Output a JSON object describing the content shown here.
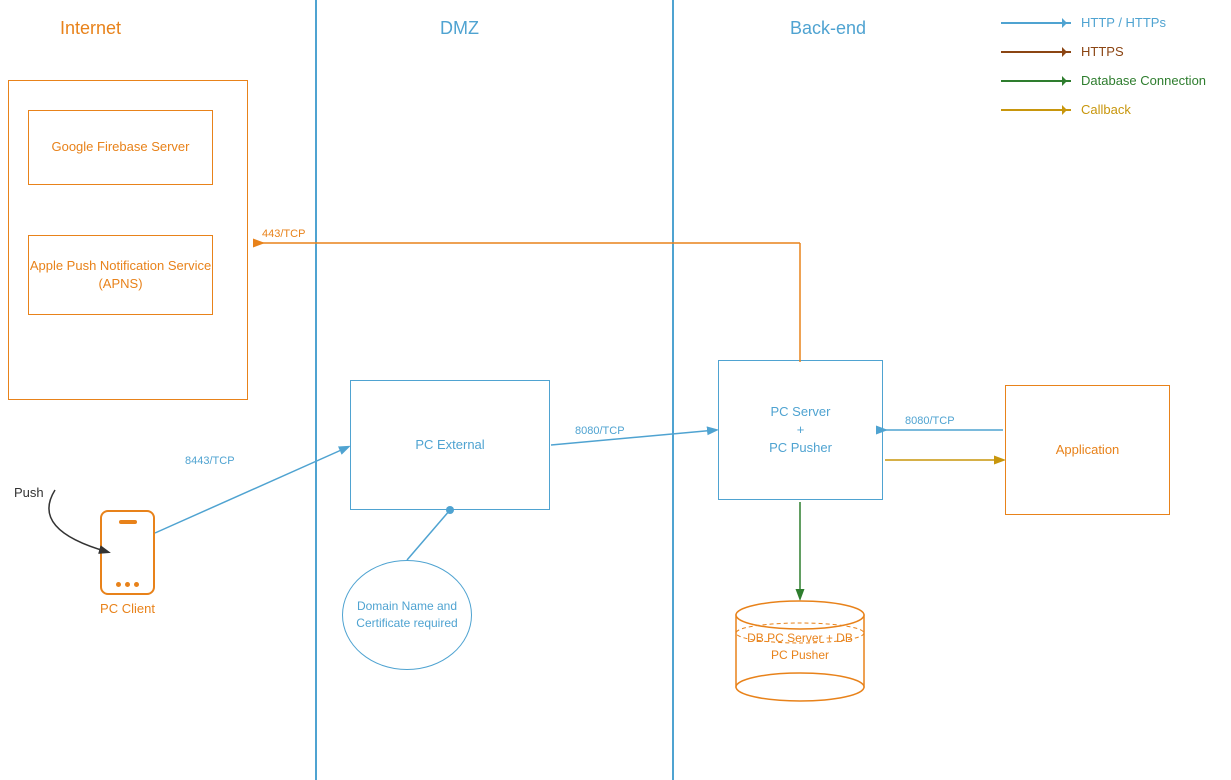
{
  "zones": {
    "internet": "Internet",
    "dmz": "DMZ",
    "backend": "Back-end"
  },
  "boxes": {
    "firebase": "Google Firebase Server",
    "apns": "Apple Push Notification Service (APNS)",
    "pcExternal": "PC External",
    "pcServer": "PC Server\n+\nPC Pusher",
    "application": "Application",
    "dbServer": "DB PC Server\n+\nDB PC Pusher",
    "pcClient": "PC Client"
  },
  "labels": {
    "push": "Push",
    "domainName": "Domain Name and Certificate required",
    "port8443": "8443/TCP",
    "port8080_out": "8080/TCP",
    "port8080_in": "8080/TCP",
    "port443": "443/TCP"
  },
  "legend": {
    "items": [
      {
        "type": "blue",
        "label": "HTTP / HTTPs"
      },
      {
        "type": "brown",
        "label": "HTTPS"
      },
      {
        "type": "green",
        "label": "Database Connection"
      },
      {
        "type": "gold",
        "label": "Callback"
      }
    ]
  }
}
